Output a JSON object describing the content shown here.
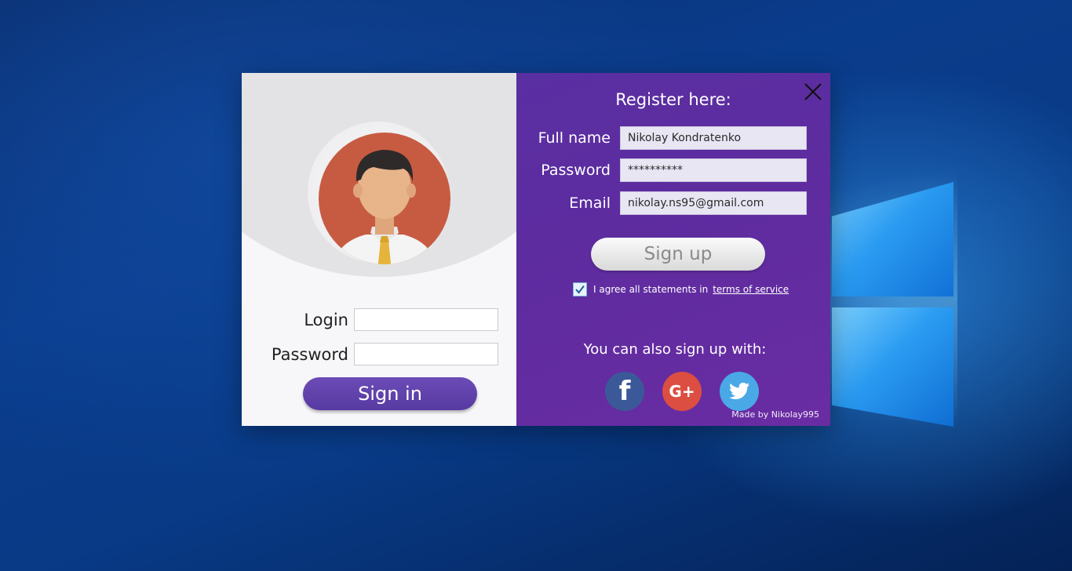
{
  "login": {
    "login_label": "Login",
    "password_label": "Password",
    "login_value": "",
    "password_value": "",
    "signin_label": "Sign in"
  },
  "register": {
    "title": "Register here:",
    "fullname_label": "Full name",
    "fullname_value": "Nikolay Kondratenko",
    "password_label": "Password",
    "password_value": "**********",
    "email_label": "Email",
    "email_value": "nikolay.ns95@gmail.com",
    "signup_label": "Sign up",
    "agree_text": "I agree all statements in",
    "agree_checked": true,
    "terms_link": "terms of service",
    "also_text": "You can also sign up with:",
    "social": {
      "facebook_glyph": "f",
      "google_glyph": "G+",
      "twitter_icon": "twitter-bird-icon"
    },
    "credit": "Made by Nikolay995"
  },
  "colors": {
    "left_bg": "#f7f7f9",
    "right_bg": "#5d2c9f",
    "signin_btn": "#5e40aa",
    "facebook": "#3b5998",
    "google": "#dc4e41",
    "twitter": "#4aa8e6"
  }
}
